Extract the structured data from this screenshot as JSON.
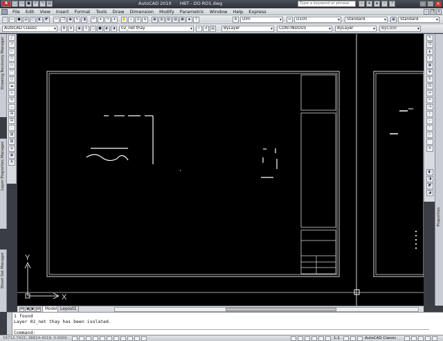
{
  "title_bar": {
    "app_name": "AutoCAD 2010",
    "file_name": "HBT - DO RO1.dwg",
    "search_placeholder": "Type a keyword or phrase"
  },
  "menu": [
    "File",
    "Edit",
    "View",
    "Insert",
    "Format",
    "Tools",
    "Draw",
    "Dimension",
    "Modify",
    "Parametric",
    "Window",
    "Help",
    "Express"
  ],
  "toolbar1": {
    "dim_style": "Dim",
    "dim_scale": "D100",
    "text_style": "Standard",
    "table_style": "Standard"
  },
  "toolbar2": {
    "workspace": "AutoCAD Classic",
    "layer": "02_net thay",
    "color": "ByLayer",
    "linetype": "CONTINUOUS",
    "lineweight": "ByLayer",
    "plot_style": "ByColor"
  },
  "palettes": {
    "left_top": "Drawing Recovery Manager",
    "left_mid": "Layer Properties Manager",
    "left_bottom": "Sheet Set Manager",
    "right": "Properties"
  },
  "ucs": {
    "x_label": "X",
    "y_label": "Y"
  },
  "tabs": {
    "model": "Model",
    "layout": "Layout1"
  },
  "command": {
    "history": [
      "1 found",
      "Layer 02_net thay has been isolated."
    ],
    "prompt": "Command:"
  },
  "status": {
    "coords": "58712.7415, 36814.4019, 0.0000",
    "anno_scale": "1:1",
    "workspace": "AutoCAD Classic"
  }
}
